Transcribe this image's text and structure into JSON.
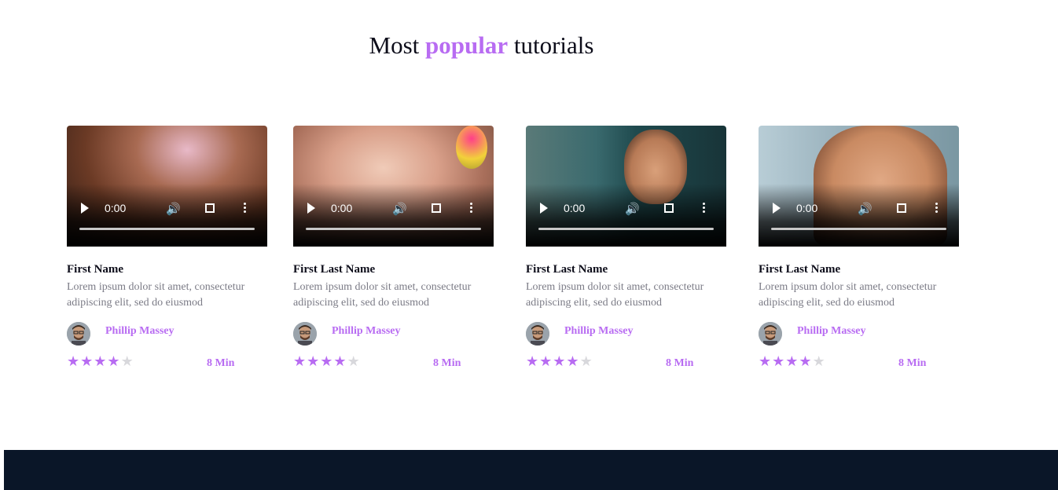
{
  "section": {
    "title_prefix": "Most",
    "title_accent": "popular",
    "title_suffix": "tutorials"
  },
  "colors": {
    "accent": "#b86cf2",
    "footer": "#0a1628"
  },
  "cards": [
    {
      "name": "First Name",
      "description": "Lorem ipsum dolor sit amet, consectetur adipiscing elit, sed do eiusmod",
      "author": "Phillip Massey",
      "time": "0:00",
      "duration": "8 Min",
      "rating": 4,
      "rating_max": 5
    },
    {
      "name": "First Last Name",
      "description": "Lorem ipsum dolor sit amet, consectetur adipiscing elit, sed do eiusmod",
      "author": "Phillip Massey",
      "time": "0:00",
      "duration": "8 Min",
      "rating": 4,
      "rating_max": 5
    },
    {
      "name": "First Last Name",
      "description": "Lorem ipsum dolor sit amet, consectetur adipiscing elit, sed do eiusmod",
      "author": "Phillip Massey",
      "time": "0:00",
      "duration": "8 Min",
      "rating": 4,
      "rating_max": 5
    },
    {
      "name": "First Last Name",
      "description": "Lorem ipsum dolor sit amet, consectetur adipiscing elit, sed do eiusmod",
      "author": "Phillip Massey",
      "time": "0:00",
      "duration": "8 Min",
      "rating": 4,
      "rating_max": 5
    }
  ]
}
